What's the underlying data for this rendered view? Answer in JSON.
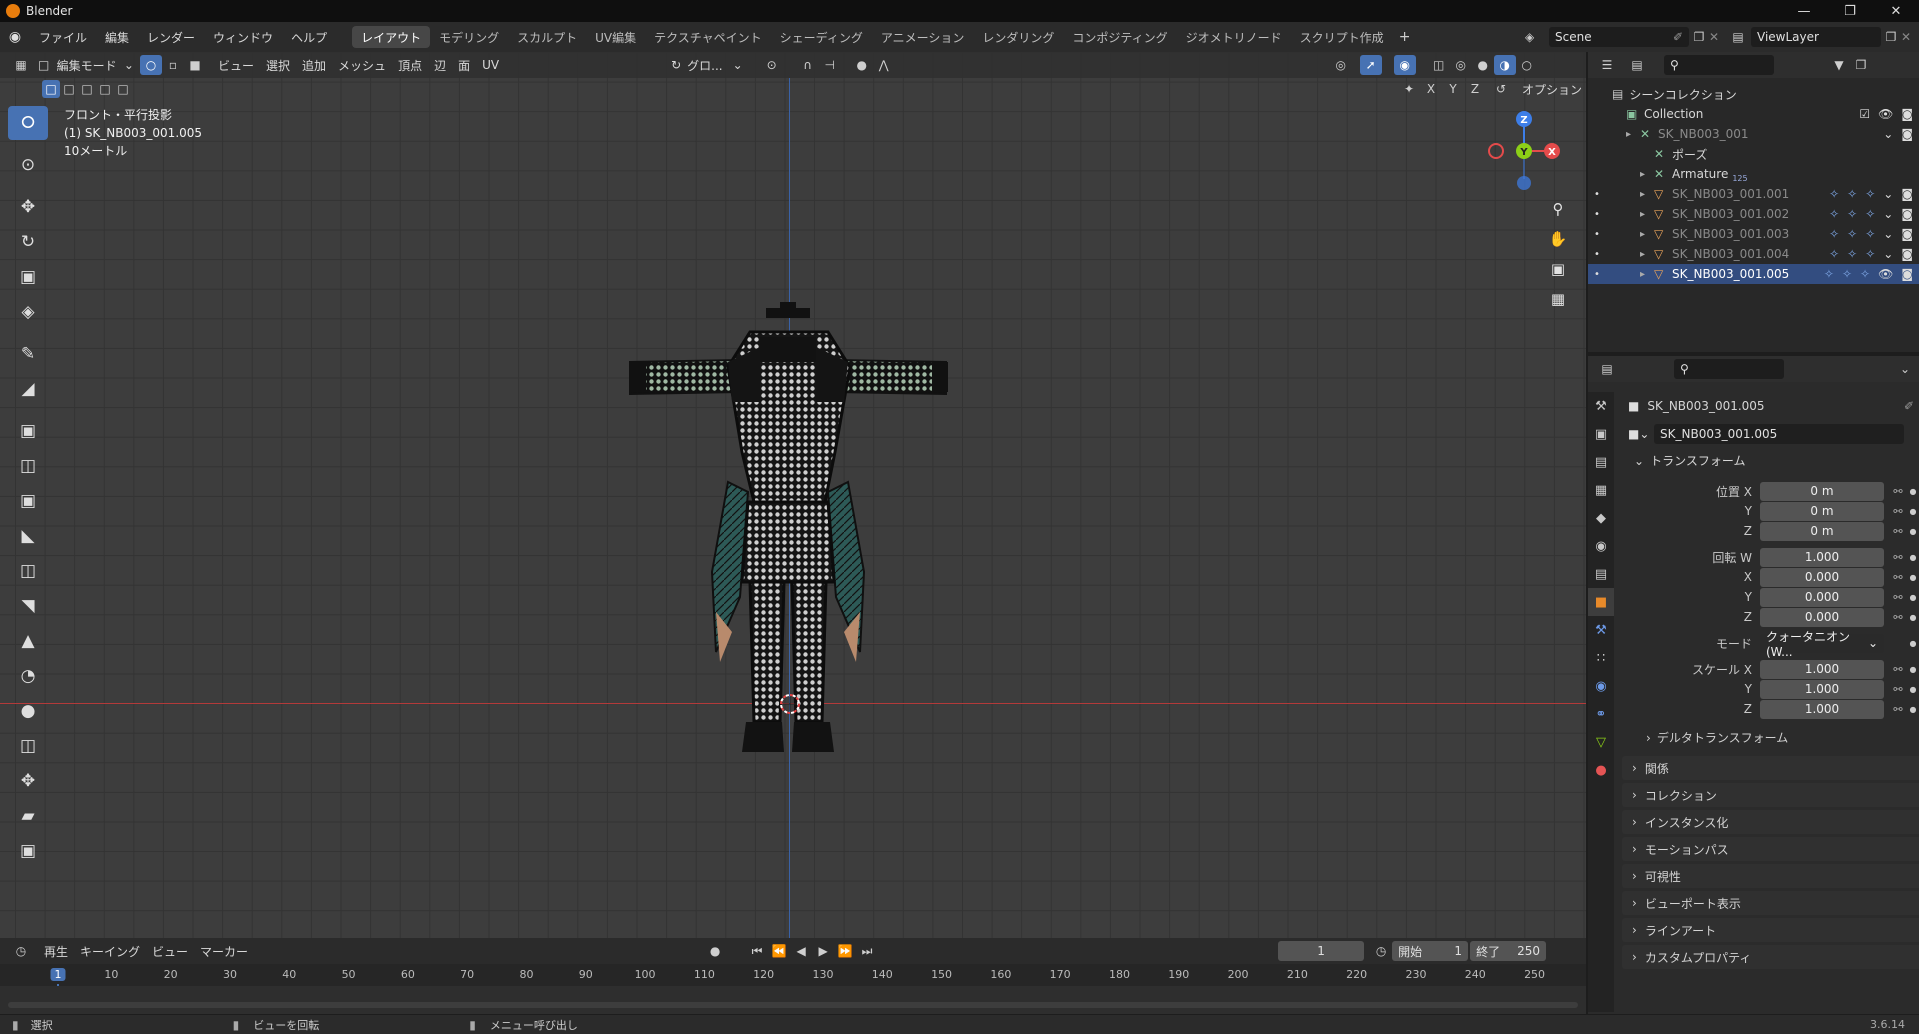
{
  "app": {
    "title": "Blender",
    "version": "3.6.14"
  },
  "menus": [
    "ファイル",
    "編集",
    "レンダー",
    "ウィンドウ",
    "ヘルプ"
  ],
  "workspaces": [
    {
      "label": "レイアウト",
      "active": true
    },
    {
      "label": "モデリング"
    },
    {
      "label": "スカルプト"
    },
    {
      "label": "UV編集"
    },
    {
      "label": "テクスチャペイント"
    },
    {
      "label": "シェーディング"
    },
    {
      "label": "アニメーション"
    },
    {
      "label": "レンダリング"
    },
    {
      "label": "コンポジティング"
    },
    {
      "label": "ジオメトリノード"
    },
    {
      "label": "スクリプト作成"
    }
  ],
  "scene": {
    "name": "Scene",
    "view_layer": "ViewLayer"
  },
  "viewport": {
    "mode": "編集モード",
    "menu": [
      "ビュー",
      "選択",
      "追加",
      "メッシュ",
      "頂点",
      "辺",
      "面",
      "UV"
    ],
    "transform_orientation": "グロ...",
    "options": "オプション",
    "axes": [
      "X",
      "Y",
      "Z"
    ],
    "overlay_lines": [
      "フロント・平行投影",
      "(1) SK_NB003_001.005",
      "10メートル"
    ],
    "gizmo": {
      "z": "Z",
      "y": "Y",
      "x": "X"
    }
  },
  "outliner": {
    "title": "シーンコレクション",
    "items": [
      {
        "label": "Collection",
        "depth": 0
      },
      {
        "label": "SK_NB003_001",
        "depth": 1,
        "dim": true
      },
      {
        "label": "ポーズ",
        "depth": 2
      },
      {
        "label": "Armature",
        "depth": 2,
        "badge": "125"
      },
      {
        "label": "SK_NB003_001.001",
        "depth": 2,
        "dim": true
      },
      {
        "label": "SK_NB003_001.002",
        "depth": 2,
        "dim": true
      },
      {
        "label": "SK_NB003_001.003",
        "depth": 2,
        "dim": true
      },
      {
        "label": "SK_NB003_001.004",
        "depth": 2,
        "dim": true
      },
      {
        "label": "SK_NB003_001.005",
        "depth": 2,
        "selected": true
      }
    ]
  },
  "properties": {
    "object_name": "SK_NB003_001.005",
    "object_field": "SK_NB003_001.005",
    "transform_header": "トランスフォーム",
    "location": {
      "label_x": "位置 X",
      "label_y": "Y",
      "label_z": "Z",
      "x": "0 m",
      "y": "0 m",
      "z": "0 m"
    },
    "rotation": {
      "label_w": "回転 W",
      "label_x": "X",
      "label_y": "Y",
      "label_z": "Z",
      "w": "1.000",
      "x": "0.000",
      "y": "0.000",
      "z": "0.000"
    },
    "mode": {
      "label": "モード",
      "value": "クォータニオン(W..."
    },
    "scale": {
      "label_x": "スケール X",
      "label_y": "Y",
      "label_z": "Z",
      "x": "1.000",
      "y": "1.000",
      "z": "1.000"
    },
    "delta": "デルタトランスフォーム",
    "panels": [
      "関係",
      "コレクション",
      "インスタンス化",
      "モーションパス",
      "可視性",
      "ビューポート表示",
      "ラインアート",
      "カスタムプロパティ"
    ]
  },
  "timeline": {
    "menu": [
      "再生",
      "キーイング",
      "ビュー",
      "マーカー"
    ],
    "current_frame": "1",
    "start_label": "開始",
    "start": "1",
    "end_label": "終了",
    "end": "250",
    "ticks": [
      "1",
      "10",
      "20",
      "30",
      "40",
      "50",
      "60",
      "70",
      "80",
      "90",
      "100",
      "110",
      "120",
      "130",
      "140",
      "150",
      "160",
      "170",
      "180",
      "190",
      "200",
      "210",
      "220",
      "230",
      "240",
      "250"
    ]
  },
  "status": {
    "select": "選択",
    "rotate": "ビューを回転",
    "menu": "メニュー呼び出し"
  },
  "colors": {
    "accent": "#4772b3",
    "selected_row": "#334d80",
    "x_axis": "#e44b4b",
    "y_axis": "#8ccf17",
    "z_axis": "#3d7ee8"
  }
}
